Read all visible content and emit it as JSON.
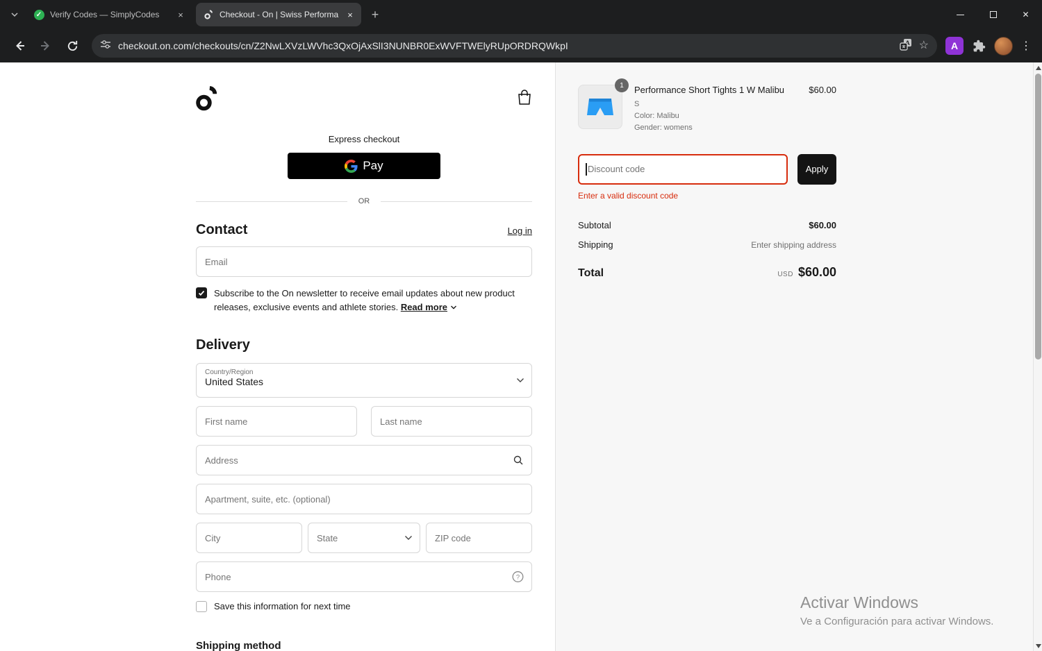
{
  "browser": {
    "tabs": [
      {
        "title": "Verify Codes — SimplyCodes"
      },
      {
        "title": "Checkout - On | Swiss Performa"
      }
    ],
    "url": "checkout.on.com/checkouts/cn/Z2NwLXVzLWVhc3QxOjAxSlI3NUNBR0ExWVFTWElyRUpORDRQWkpI",
    "extension_badge": "A"
  },
  "checkout": {
    "express_label": "Express checkout",
    "gpay_label": "Pay",
    "divider_label": "OR",
    "contact_heading": "Contact",
    "login_label": "Log in",
    "email_placeholder": "Email",
    "newsletter_text": "Subscribe to the On newsletter to receive email updates about new product releases, exclusive events and athlete stories. ",
    "read_more_label": "Read more",
    "delivery_heading": "Delivery",
    "country_label": "Country/Region",
    "country_value": "United States",
    "first_name_placeholder": "First name",
    "last_name_placeholder": "Last name",
    "address_placeholder": "Address",
    "apartment_placeholder": "Apartment, suite, etc. (optional)",
    "city_placeholder": "City",
    "state_label": "State",
    "zip_placeholder": "ZIP code",
    "phone_placeholder": "Phone",
    "save_info_label": "Save this information for next time",
    "shipping_heading": "Shipping method"
  },
  "summary": {
    "item_qty": "1",
    "item_title": "Performance Short Tights 1 W Malibu",
    "item_price": "$60.00",
    "item_size": "S",
    "item_color": "Color: Malibu",
    "item_gender": "Gender: womens",
    "discount_placeholder": "Discount code",
    "apply_label": "Apply",
    "discount_error": "Enter a valid discount code",
    "subtotal_label": "Subtotal",
    "subtotal_value": "$60.00",
    "shipping_label": "Shipping",
    "shipping_value": "Enter shipping address",
    "total_label": "Total",
    "currency_label": "USD",
    "total_value": "$60.00"
  },
  "watermark": {
    "line1": "Activar Windows",
    "line2": "Ve a Configuración para activar Windows."
  },
  "colors": {
    "error_red": "#d72c0d",
    "product_blue": "#2a9df4",
    "apply_black": "#141414",
    "extension_purple": "#8f33d6"
  }
}
